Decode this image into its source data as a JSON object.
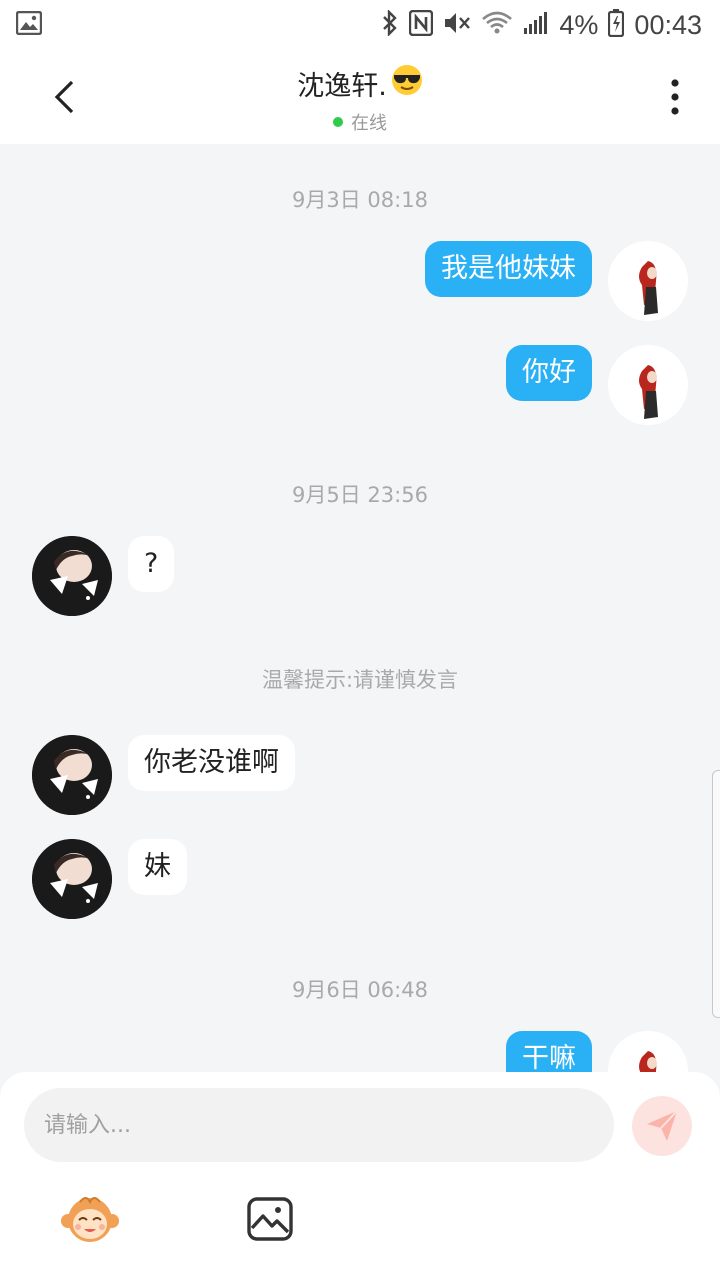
{
  "status_bar": {
    "battery": "4%",
    "time": "00:43"
  },
  "header": {
    "title": "沈逸轩.",
    "status": "在线"
  },
  "messages": {
    "time1": "9月3日 08:18",
    "out1": "我是他妹妹",
    "out2": "你好",
    "time2": "9月5日 23:56",
    "in1": "?",
    "tip": "温馨提示:请谨慎发言",
    "in2": "你老没谁啊",
    "in3": "妹",
    "time3": "9月6日 06:48",
    "out3": "干嘛"
  },
  "input": {
    "placeholder": "请输入..."
  },
  "colors": {
    "bubble_out": "#2ab0f5",
    "online_dot": "#2ecc4a",
    "send_bg": "#fde3e0"
  }
}
